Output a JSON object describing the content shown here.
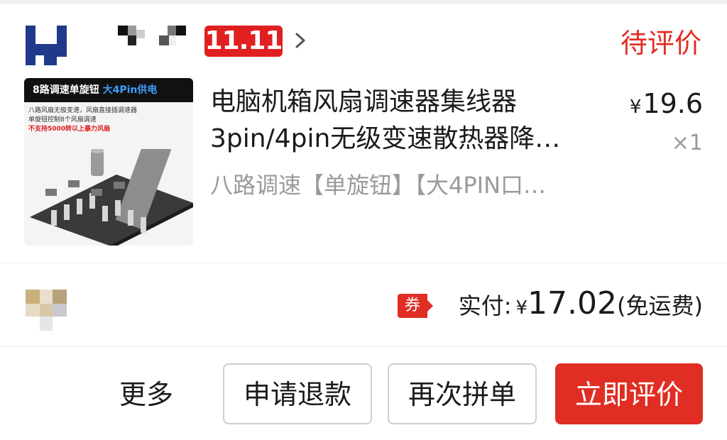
{
  "shop": {
    "promo_badge": "11.11",
    "order_status": "待评价"
  },
  "product": {
    "image_banner_text": "8路调速单旋钮",
    "image_banner_highlight": "大4Pin供电",
    "image_lines": [
      "八路风扇无极变速，风扇直接插调速器",
      "单旋钮控制8个风扇调速"
    ],
    "image_warning": "不支持5000转以上暴力风扇",
    "title": "电脑机箱风扇调速器集线器3pin/4pin无级变速散热器降…",
    "spec": "八路调速【单旋钮】【大4PIN口…",
    "currency": "¥",
    "unit_price": "19.6",
    "quantity": "×1"
  },
  "payment": {
    "coupon_label": "券",
    "paid_label": "实付:",
    "currency": "¥",
    "paid_amount": "17.02",
    "shipping_note": "(免运费)"
  },
  "actions": {
    "more_label": "更多",
    "refund_label": "申请退款",
    "rebuy_label": "再次拼单",
    "review_label": "立即评价"
  },
  "colors": {
    "accent": "#e02e24",
    "status_text": "#e02e24",
    "muted_text": "#9a9a9a"
  }
}
